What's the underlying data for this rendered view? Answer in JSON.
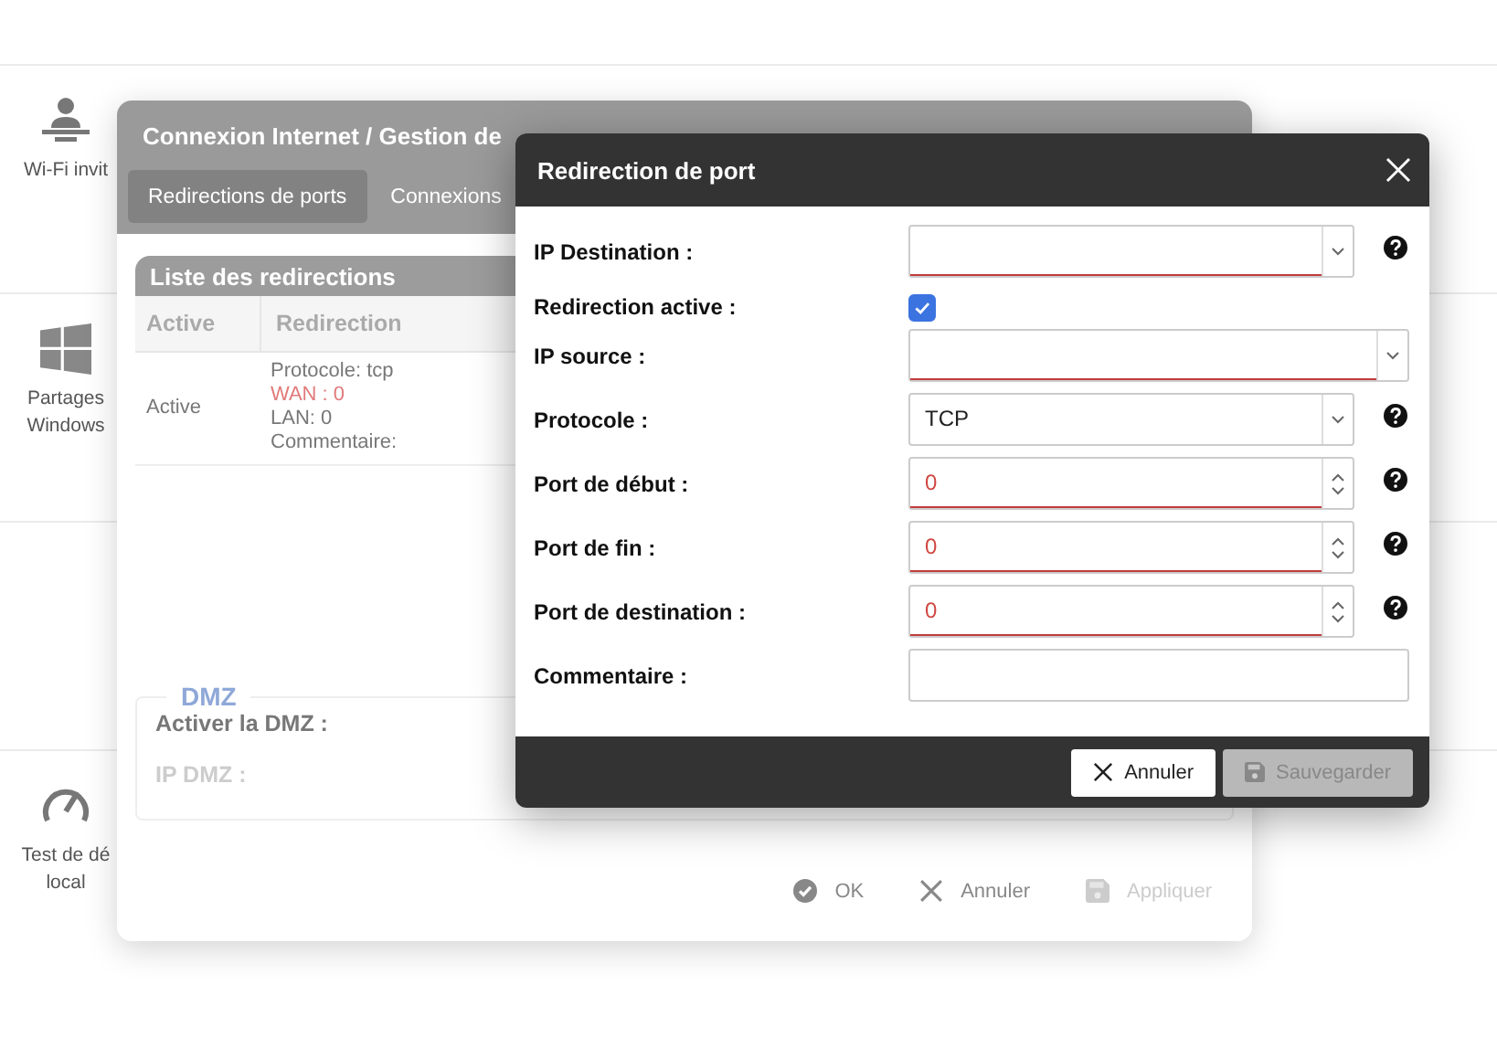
{
  "background_tiles": [
    {
      "lines": [
        "Wi-Fi invit"
      ]
    },
    {
      "lines": [
        "Partages",
        "Windows"
      ]
    },
    {
      "lines": [
        "Test de dé",
        "local"
      ]
    }
  ],
  "back_window": {
    "title": "Connexion Internet / Gestion de",
    "tabs": [
      {
        "label": "Redirections de ports",
        "selected": true
      },
      {
        "label": "Connexions",
        "selected": false
      }
    ],
    "list": {
      "title": "Liste des redirections",
      "columns": [
        "Active",
        "Redirection"
      ],
      "rows": [
        {
          "active": "Active",
          "details": [
            {
              "text": "Protocole: tcp",
              "error": false
            },
            {
              "text": "WAN : 0",
              "error": true
            },
            {
              "text": "LAN: 0",
              "error": false
            },
            {
              "text": "Commentaire:",
              "error": false
            }
          ]
        }
      ]
    },
    "dmz": {
      "legend": "DMZ",
      "fields": [
        {
          "label": "Activer la DMZ :",
          "disabled": false
        },
        {
          "label": "IP DMZ :",
          "disabled": true
        }
      ]
    },
    "buttons": [
      {
        "label": "OK",
        "disabled": false
      },
      {
        "label": "Annuler",
        "disabled": false
      },
      {
        "label": "Appliquer",
        "disabled": true
      }
    ]
  },
  "dialog": {
    "title": "Redirection de port",
    "fields": [
      {
        "label": "IP Destination :",
        "kind": "combo",
        "invalid": true,
        "help": true
      },
      {
        "label": "Redirection active :",
        "kind": "checkbox",
        "checked": true,
        "help": false
      },
      {
        "label": "IP source :",
        "kind": "combo",
        "invalid": true,
        "help": false
      },
      {
        "label": "Protocole :",
        "kind": "select",
        "value": "TCP",
        "invalid": false,
        "help": true
      },
      {
        "label": "Port de début :",
        "kind": "number",
        "value": "0",
        "invalid": true,
        "help": true
      },
      {
        "label": "Port de fin :",
        "kind": "number",
        "value": "0",
        "invalid": true,
        "help": true
      },
      {
        "label": "Port de destination :",
        "kind": "number",
        "value": "0",
        "invalid": true,
        "help": true
      },
      {
        "label": "Commentaire :",
        "kind": "text",
        "invalid": false,
        "help": false
      }
    ],
    "buttons": [
      {
        "label": "Annuler",
        "disabled": false
      },
      {
        "label": "Sauvegarder",
        "disabled": true
      }
    ]
  }
}
